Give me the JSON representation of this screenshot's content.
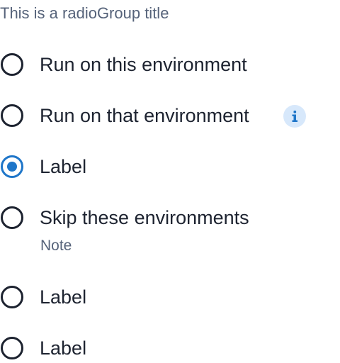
{
  "radio_group": {
    "title": "This is a radioGroup title",
    "options": [
      {
        "label": "Run on this environment",
        "selected": false
      },
      {
        "label": "Run on that environment",
        "selected": false,
        "has_info_icon": true
      },
      {
        "label": "Label",
        "selected": true
      },
      {
        "label": "Skip these environments",
        "selected": false,
        "note": "Note"
      },
      {
        "label": "Label",
        "selected": false
      },
      {
        "label": "Label",
        "selected": false
      }
    ]
  },
  "icons": {
    "info": "info-icon"
  },
  "colors": {
    "text_primary": "#1d2330",
    "text_secondary": "#56637a",
    "accent": "#1f76c9",
    "info_background": "#d7e8fb"
  }
}
